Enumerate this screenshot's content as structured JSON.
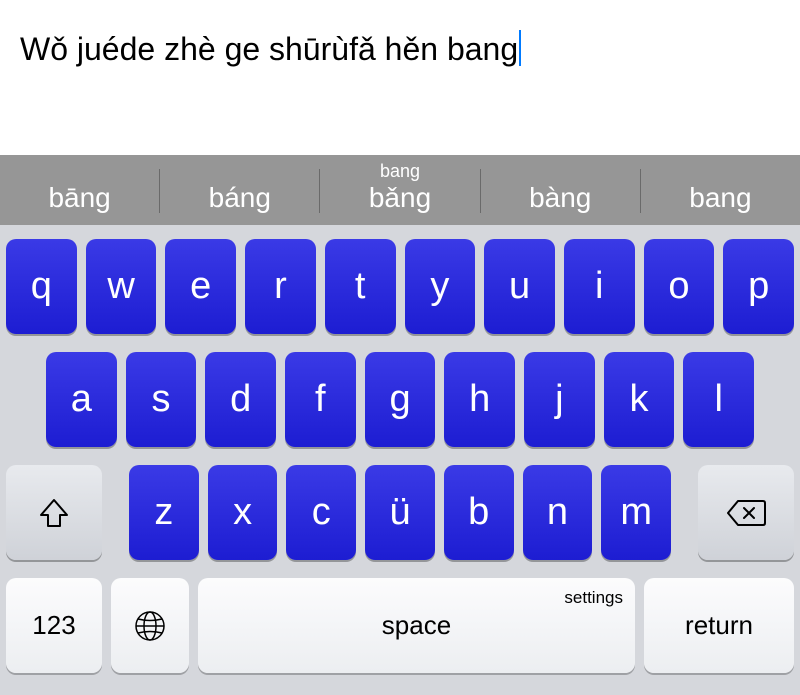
{
  "input": {
    "text": "Wǒ juéde zhè ge shūrùfǎ hěn bang"
  },
  "candidates": {
    "typed": "bang",
    "items": [
      {
        "label": "bāng"
      },
      {
        "label": "báng"
      },
      {
        "label": "bǎng"
      },
      {
        "label": "bàng"
      },
      {
        "label": "bang"
      }
    ]
  },
  "keys": {
    "row1": [
      "q",
      "w",
      "e",
      "r",
      "t",
      "y",
      "u",
      "i",
      "o",
      "p"
    ],
    "row2": [
      "a",
      "s",
      "d",
      "f",
      "g",
      "h",
      "j",
      "k",
      "l"
    ],
    "row3": [
      "z",
      "x",
      "c",
      "ü",
      "b",
      "n",
      "m"
    ],
    "num": "123",
    "space": "space",
    "settings": "settings",
    "return": "return"
  }
}
